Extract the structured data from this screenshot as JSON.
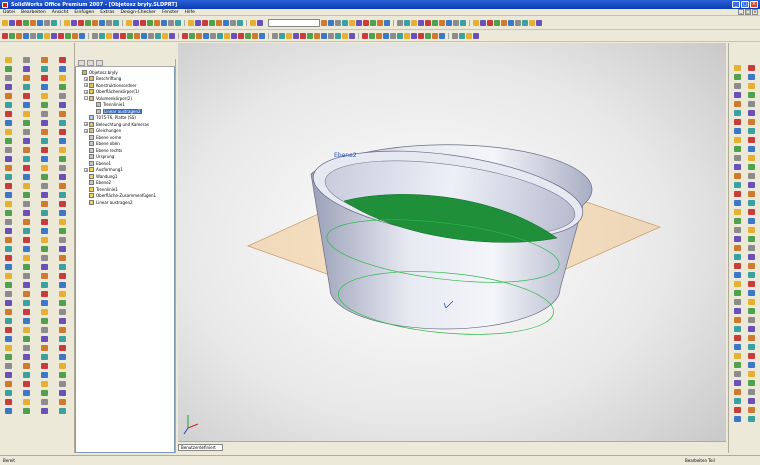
{
  "window": {
    "title": "SolidWorks Office Premium 2007 - [Objetosz bryły.SLDPRT]",
    "controls": [
      "_",
      "□",
      "×"
    ]
  },
  "menu": [
    "Datei",
    "Bearbeiten",
    "Ansicht",
    "Einfügen",
    "Extras",
    "Design-Checker",
    "Fenster",
    "Hilfe"
  ],
  "toolbar": {
    "config_placeholder": ""
  },
  "feature_tree": {
    "items": [
      {
        "label": "Objetosz bryły",
        "indent": 0,
        "exp": "",
        "color": "#d8b050"
      },
      {
        "label": "Beschriftung",
        "indent": 1,
        "exp": "+",
        "color": "#e8c060"
      },
      {
        "label": "Konstruktionsordner",
        "indent": 1,
        "exp": "+",
        "color": "#e8c060"
      },
      {
        "label": "Oberflächenkörper(1)",
        "indent": 1,
        "exp": "+",
        "color": "#e8c060"
      },
      {
        "label": "Volumenkörper(2)",
        "indent": 1,
        "exp": "-",
        "color": "#e8c060"
      },
      {
        "label": "Trennlinie1",
        "indent": 2,
        "exp": "",
        "color": "#c0c0c0"
      },
      {
        "label": "Linear austragen2",
        "indent": 2,
        "exp": "",
        "color": "#c0c0c0",
        "selected": true
      },
      {
        "label": "7075-T6, Platte (SS)",
        "indent": 1,
        "exp": "",
        "color": "#b0c8e0"
      },
      {
        "label": "Beleuchtung und Kameras",
        "indent": 1,
        "exp": "+",
        "color": "#e8c060"
      },
      {
        "label": "Gleichungen",
        "indent": 1,
        "exp": "+",
        "color": "#e8c060"
      },
      {
        "label": "Ebene vorne",
        "indent": 1,
        "exp": "",
        "color": "#c8c8c8"
      },
      {
        "label": "Ebene oben",
        "indent": 1,
        "exp": "",
        "color": "#c8c8c8"
      },
      {
        "label": "Ebene rechts",
        "indent": 1,
        "exp": "",
        "color": "#c8c8c8"
      },
      {
        "label": "Ursprung",
        "indent": 1,
        "exp": "",
        "color": "#c8c8c8"
      },
      {
        "label": "Ebene1",
        "indent": 1,
        "exp": "",
        "color": "#c8c8c8"
      },
      {
        "label": "Ausformung1",
        "indent": 1,
        "exp": "+",
        "color": "#f0d060"
      },
      {
        "label": "Wandung1",
        "indent": 1,
        "exp": "",
        "color": "#f0d060"
      },
      {
        "label": "Ebene2",
        "indent": 1,
        "exp": "",
        "color": "#c8c8c8"
      },
      {
        "label": "Trennlinie1",
        "indent": 1,
        "exp": "",
        "color": "#f0d060"
      },
      {
        "label": "Oberfläche-Zusammenfügen1",
        "indent": 1,
        "exp": "",
        "color": "#f0d060"
      },
      {
        "label": "Linear austragen2",
        "indent": 1,
        "exp": "",
        "color": "#f0d060"
      }
    ]
  },
  "graphics": {
    "plane_label": "Ebene2"
  },
  "bottom_tab": {
    "label": "Benutzerdefiniert"
  },
  "status": {
    "left": "Bereit",
    "right": "Bearbeiten Teil"
  },
  "colors": {
    "accent": "#0a3cb0",
    "green_face": "#1f8f3a",
    "plane": "#f0c890"
  }
}
